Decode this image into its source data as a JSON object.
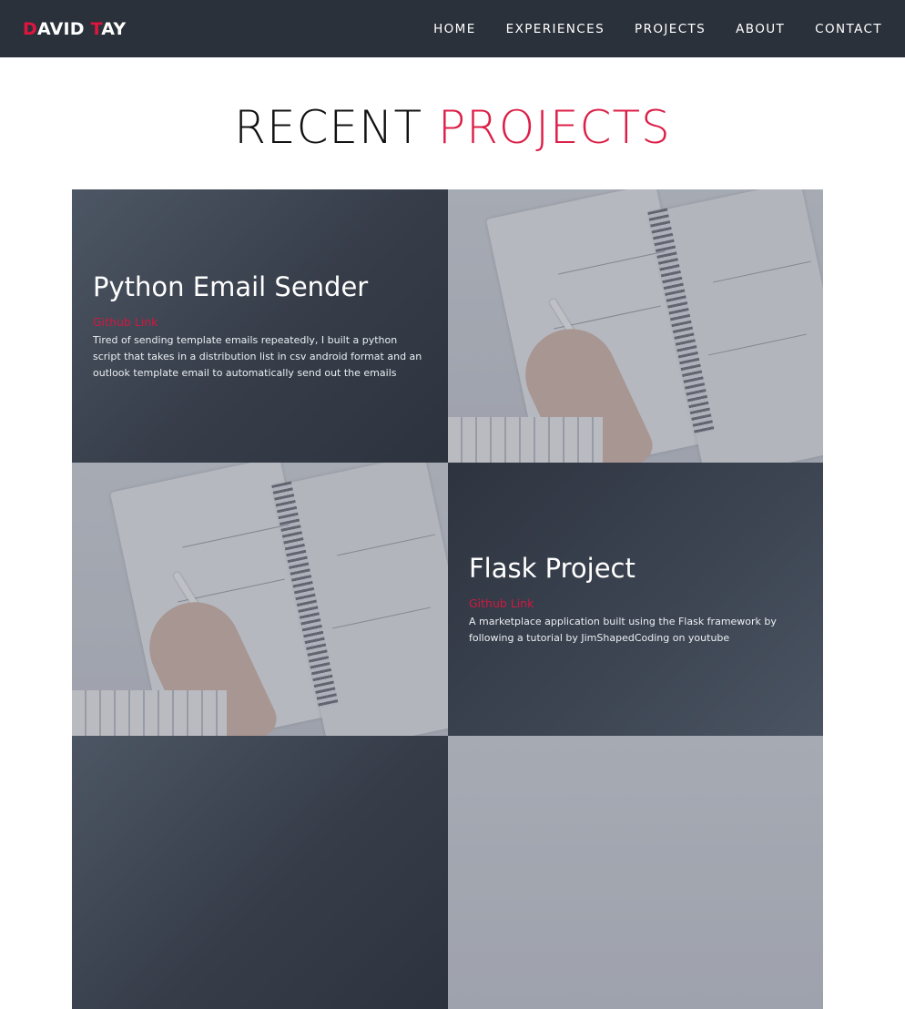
{
  "brand": {
    "first_initial": "D",
    "first_rest": "AVID ",
    "last_initial": "T",
    "last_rest": "AY"
  },
  "nav": [
    {
      "label": "HOME"
    },
    {
      "label": "EXPERIENCES"
    },
    {
      "label": "PROJECTS"
    },
    {
      "label": "ABOUT"
    },
    {
      "label": "CONTACT"
    }
  ],
  "section": {
    "title_plain": "RECENT ",
    "title_accent": "PROJECTS"
  },
  "projects": [
    {
      "title": "Python Email Sender",
      "link_label": "Github Link",
      "description": "Tired of sending template emails repeatedly, I built a python script that takes in a distribution list in csv android format and an outlook template email to automatically send out the emails"
    },
    {
      "title": "Flask Project",
      "link_label": "Github Link",
      "description": "A marketplace application built using the Flask framework by following a tutorial by JimShapedCoding on youtube"
    }
  ],
  "colors": {
    "navbar": "#2b313b",
    "accent": "#dc1f47",
    "card": "#363d49"
  }
}
